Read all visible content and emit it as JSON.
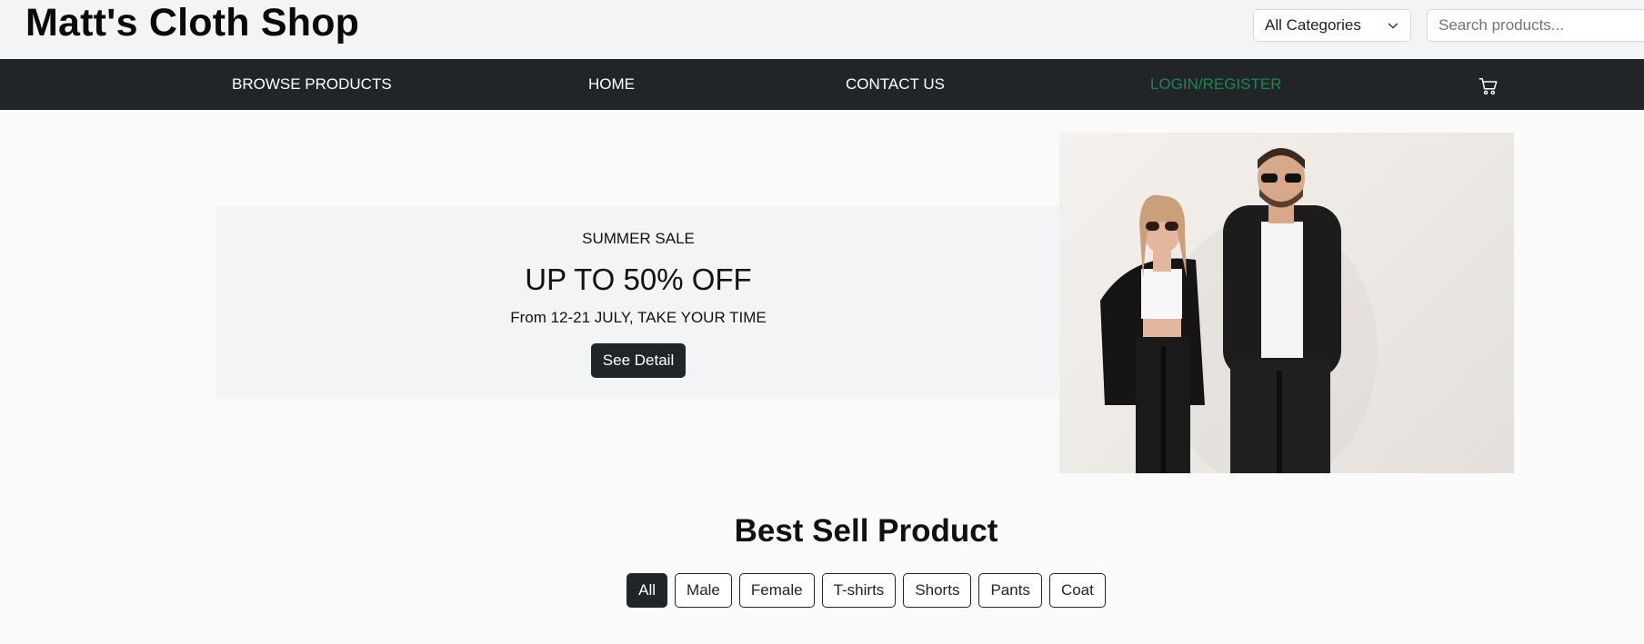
{
  "header": {
    "logo": "Matt's Cloth Shop",
    "category_select": {
      "value": "All Categories"
    },
    "search": {
      "placeholder": "Search products..."
    }
  },
  "nav": {
    "browse": "BROWSE PRODUCTS",
    "home": "HOME",
    "contact": "CONTACT US",
    "login": "LOGIN/REGISTER",
    "cart_icon": "cart-icon"
  },
  "hero": {
    "eyebrow": "SUMMER SALE",
    "headline": "UP TO 50% OFF",
    "subtext": "From 12-21 JULY, TAKE YOUR TIME",
    "button": "See Detail"
  },
  "best_sell": {
    "title": "Best Sell Product",
    "filters": [
      {
        "label": "All",
        "active": true
      },
      {
        "label": "Male"
      },
      {
        "label": "Female"
      },
      {
        "label": "T-shirts"
      },
      {
        "label": "Shorts"
      },
      {
        "label": "Pants"
      },
      {
        "label": "Coat"
      }
    ]
  },
  "colors": {
    "nav_bg": "#212529",
    "login_accent": "#198754",
    "page_bg": "#fafafa",
    "header_bg": "#f3f4f6"
  }
}
